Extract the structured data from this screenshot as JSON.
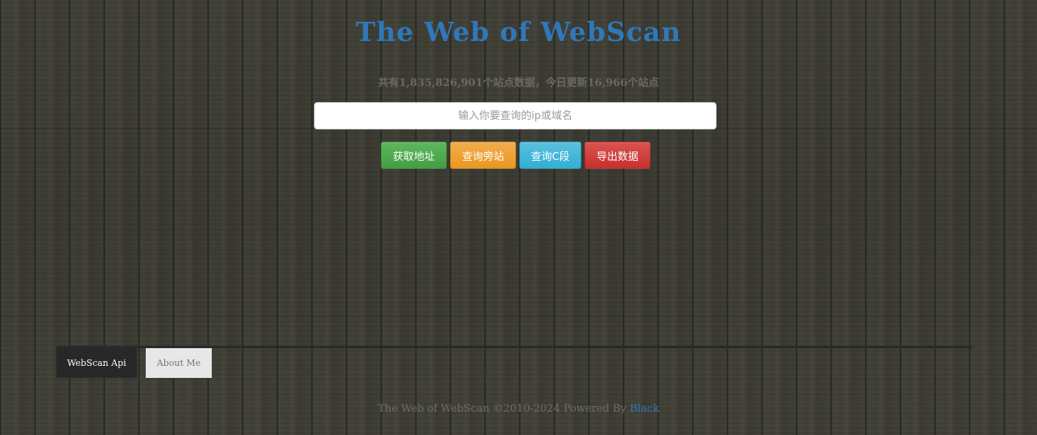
{
  "header": {
    "title": "The Web of WebScan",
    "stats": "共有1,835,826,901个站点数据，今日更新16,966个站点"
  },
  "search": {
    "placeholder": "输入你要查询的ip或域名",
    "value": ""
  },
  "buttons": {
    "get_address": "获取地址",
    "query_sites": "查询旁站",
    "query_c_segment": "查询C段",
    "export_data": "导出数据"
  },
  "tabs": {
    "api": "WebScan Api",
    "about": "About Me"
  },
  "footer": {
    "copyright": "The Web of WebScan ©2010-2024 Powered By ",
    "author_link": "Black"
  },
  "colors": {
    "title": "#2f78b9",
    "green": "#5cb85c",
    "orange": "#f0ad4e",
    "cyan": "#5bc0de",
    "red": "#d9534f",
    "link": "#337ab7"
  }
}
